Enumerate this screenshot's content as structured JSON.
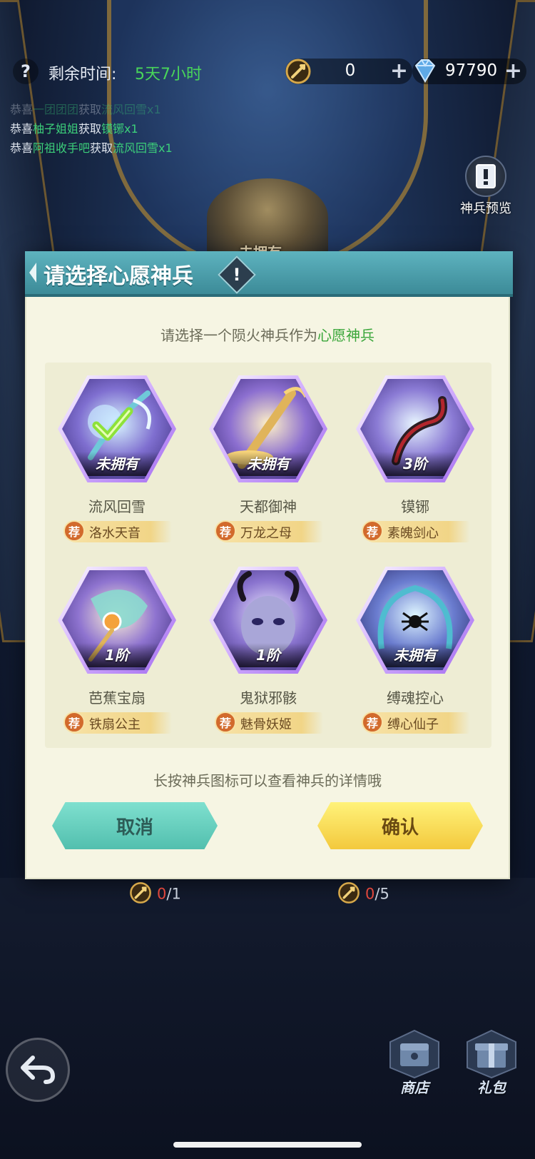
{
  "top_bar": {
    "help_icon": "?",
    "time_label": "剩余时间:",
    "time_value": "5天7小时",
    "tokens": {
      "icon": "token-icon",
      "value": "0",
      "plus": "+"
    },
    "gems": {
      "icon": "diamond-icon",
      "value": "97790",
      "plus": "+"
    }
  },
  "feed": [
    {
      "prefix": "恭喜",
      "name": "一团团团",
      "verb": "获取",
      "item": "流风回雪x1"
    },
    {
      "prefix": "恭喜",
      "name": "柚子姐姐",
      "verb": "获取",
      "item": "镆铘x1"
    },
    {
      "prefix": "恭喜",
      "name": "阿祖收手吧",
      "verb": "获取",
      "item": "流风回雪x1"
    }
  ],
  "preview": {
    "icon": "!",
    "label": "神兵预览"
  },
  "background": {
    "emblem_label": "未拥有"
  },
  "dialog": {
    "title": "请选择心愿神兵",
    "title_info": "!",
    "subtitle_prefix": "请选择一个陨火神兵作为",
    "subtitle_highlight": "心愿神兵",
    "weapons": [
      {
        "badge": "未拥有",
        "name": "流风回雪",
        "rec_icon": "荐",
        "rec": "洛水天音",
        "selected": true,
        "palette": "#6fc9d9"
      },
      {
        "badge": "未拥有",
        "name": "天都御神",
        "rec_icon": "荐",
        "rec": "万龙之母",
        "selected": false,
        "palette": "#e0b45a"
      },
      {
        "badge": "3阶",
        "name": "镆铘",
        "rec_icon": "荐",
        "rec": "素魄剑心",
        "selected": false,
        "palette": "#b3262d"
      },
      {
        "badge": "1阶",
        "name": "芭蕉宝扇",
        "rec_icon": "荐",
        "rec": "铁扇公主",
        "selected": false,
        "palette": "#8ad9cf"
      },
      {
        "badge": "1阶",
        "name": "鬼狱邪骸",
        "rec_icon": "荐",
        "rec": "魅骨妖姬",
        "selected": false,
        "palette": "#a9a6d8"
      },
      {
        "badge": "未拥有",
        "name": "缚魂控心",
        "rec_icon": "荐",
        "rec": "缚心仙子",
        "selected": false,
        "palette": "#4fbcd0"
      }
    ],
    "hint": "长按神兵图标可以查看神兵的详情哦",
    "cancel": "取消",
    "confirm": "确认"
  },
  "counters": [
    {
      "current": "0",
      "total": "/1"
    },
    {
      "current": "0",
      "total": "/5"
    }
  ],
  "bottom": {
    "shop": "商店",
    "gift": "礼包"
  },
  "colors": {
    "accent_green": "#3aa63a",
    "header_teal": "#4a9fac",
    "cancel_teal": "#52bfae",
    "confirm_yellow": "#f3c93d",
    "counter_red": "#e0473c"
  }
}
